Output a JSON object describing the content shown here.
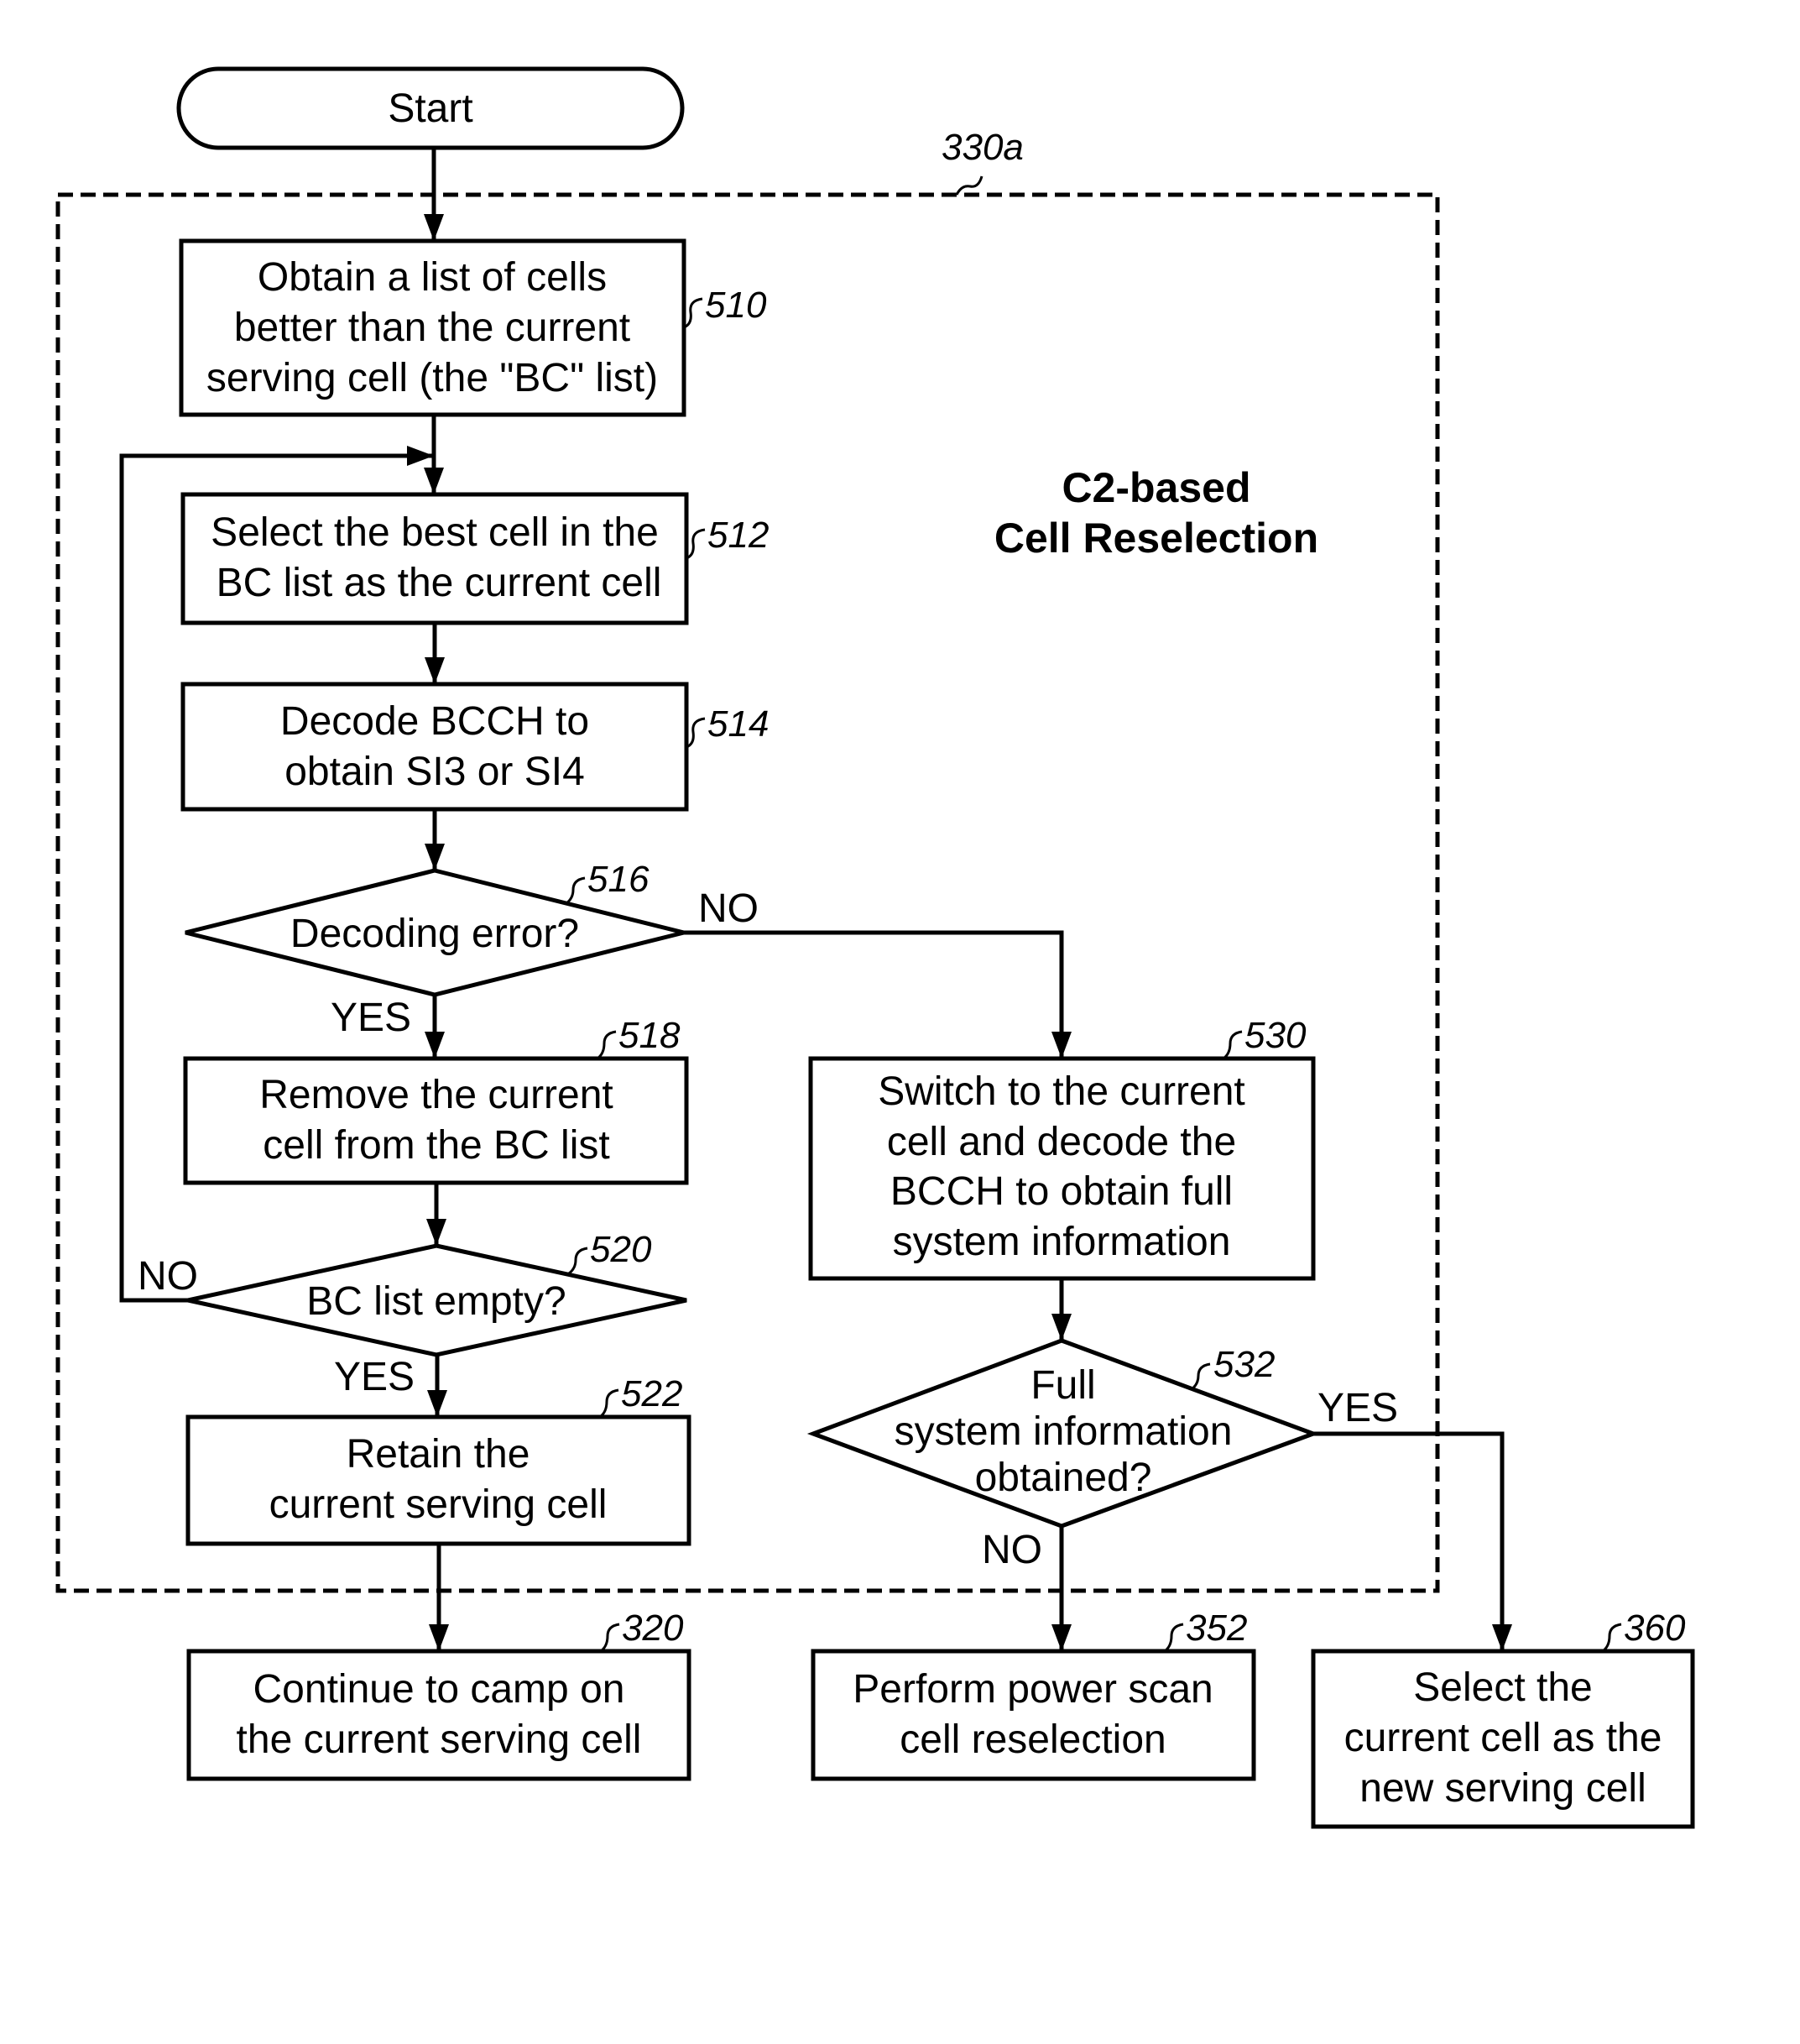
{
  "diagram": {
    "type": "flowchart",
    "region": {
      "ref": "330a",
      "title_lines": [
        "C2-based",
        "Cell Reselection"
      ]
    },
    "nodes": {
      "start": {
        "shape": "terminal",
        "lines": [
          "Start"
        ]
      },
      "n510": {
        "shape": "process",
        "ref": "510",
        "lines": [
          "Obtain a list of cells",
          "better than the current",
          "serving cell (the \"BC\" list)"
        ]
      },
      "n512": {
        "shape": "process",
        "ref": "512",
        "lines": [
          "Select the best cell in the",
          "BC list as the current cell"
        ]
      },
      "n514": {
        "shape": "process",
        "ref": "514",
        "lines": [
          "Decode BCCH to",
          "obtain SI3 or SI4"
        ]
      },
      "n516": {
        "shape": "decision",
        "ref": "516",
        "lines": [
          "Decoding error?"
        ]
      },
      "n518": {
        "shape": "process",
        "ref": "518",
        "lines": [
          "Remove the current",
          "cell from the BC list"
        ]
      },
      "n520": {
        "shape": "decision",
        "ref": "520",
        "lines": [
          "BC list empty?"
        ]
      },
      "n522": {
        "shape": "process",
        "ref": "522",
        "lines": [
          "Retain the",
          "current serving cell"
        ]
      },
      "n530": {
        "shape": "process",
        "ref": "530",
        "lines": [
          "Switch to the current",
          "cell and decode the",
          "BCCH to obtain full",
          "system information"
        ]
      },
      "n532": {
        "shape": "decision",
        "ref": "532",
        "lines": [
          "Full",
          "system information",
          "obtained?"
        ]
      },
      "n320": {
        "shape": "process",
        "ref": "320",
        "lines": [
          "Continue to camp on",
          "the current serving cell"
        ]
      },
      "n352": {
        "shape": "process",
        "ref": "352",
        "lines": [
          "Perform power scan",
          "cell reselection"
        ]
      },
      "n360": {
        "shape": "process",
        "ref": "360",
        "lines": [
          "Select the",
          "current cell as the",
          "new serving cell"
        ]
      }
    },
    "edges": [
      {
        "from": "start",
        "to": "n510",
        "label": ""
      },
      {
        "from": "n510",
        "to": "n512",
        "label": ""
      },
      {
        "from": "n512",
        "to": "n514",
        "label": ""
      },
      {
        "from": "n514",
        "to": "n516",
        "label": ""
      },
      {
        "from": "n516",
        "to": "n518",
        "label": "YES"
      },
      {
        "from": "n516",
        "to": "n530",
        "label": "NO"
      },
      {
        "from": "n518",
        "to": "n520",
        "label": ""
      },
      {
        "from": "n520",
        "to": "n512",
        "label": "NO"
      },
      {
        "from": "n520",
        "to": "n522",
        "label": "YES"
      },
      {
        "from": "n522",
        "to": "n320",
        "label": ""
      },
      {
        "from": "n530",
        "to": "n532",
        "label": ""
      },
      {
        "from": "n532",
        "to": "n360",
        "label": "YES"
      },
      {
        "from": "n532",
        "to": "n352",
        "label": "NO"
      }
    ],
    "edge_labels": {
      "e516_no": "NO",
      "e516_yes": "YES",
      "e520_no": "NO",
      "e520_yes": "YES",
      "e532_yes": "YES",
      "e532_no": "NO"
    }
  }
}
